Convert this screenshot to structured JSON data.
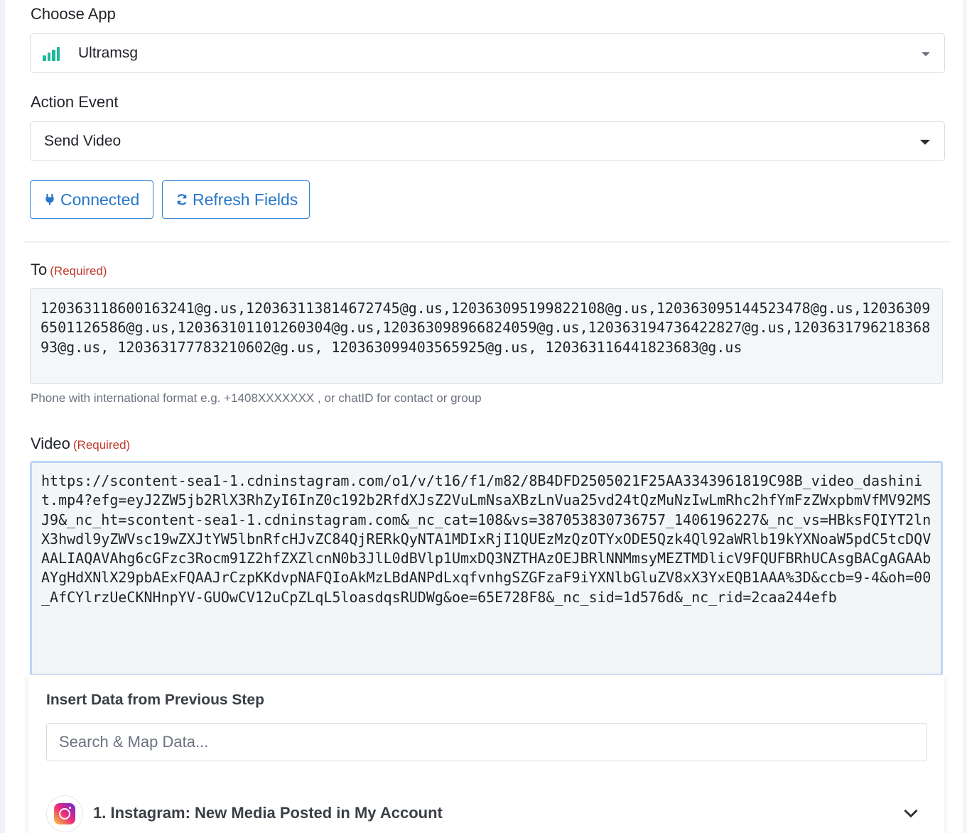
{
  "choose_app": {
    "label": "Choose App",
    "selected": "Ultramsg",
    "icon": "bar-chart-icon",
    "icon_color": "#1fb89a"
  },
  "action_event": {
    "label": "Action Event",
    "selected": "Send Video"
  },
  "buttons": {
    "connected_label": "Connected",
    "refresh_label": "Refresh Fields",
    "accent_color": "#2777c8"
  },
  "to_field": {
    "label": "To",
    "required_label": "(Required)",
    "value": "120363118600163241@g.us,120363113814672745@g.us,120363095199822108@g.us,120363095144523478@g.us,120363096501126586@g.us,120363101101260304@g.us,120363098966824059@g.us,120363194736422827@g.us,120363179621836893@g.us, 120363177783210602@g.us, 120363099403565925@g.us, 120363116441823683@g.us",
    "hint": "Phone with international format e.g. +1408XXXXXXX , or chatID for contact or group"
  },
  "video_field": {
    "label": "Video",
    "required_label": "(Required)",
    "value": "https://scontent-sea1-1.cdninstagram.com/o1/v/t16/f1/m82/8B4DFD2505021F25AA3343961819C98B_video_dashinit.mp4?efg=eyJ2ZW5jb2RlX3RhZyI6InZ0c192b2RfdXJsZ2VuLmNsaXBzLnVua25vd24tQzMuNzIwLmRhc2hfYmFzZWxpbmVfMV92MSJ9&_nc_ht=scontent-sea1-1.cdninstagram.com&_nc_cat=108&vs=387053830736757_1406196227&_nc_vs=HBksFQIYT2lnX3hwdl9yZWVsc19wZXJtYW5lbnRfcHJvZC84QjRERkQyNTA1MDIxRjI1QUEzMzQzOTYxODE5Qzk4Ql92aWRlb19kYXNoaW5pdC5tcDQVAALIAQAVAhg6cGFzc3Rocm91Z2hfZXZlcnN0b3JlL0dBVlp1UmxDQ3NZTHAzOEJBRlNNMmsyMEZTMDlicV9FQUFBRhUCAsgBACgAGAAbAYgHdXNlX29pbAExFQAAJrCzpKKdvpNAFQIoAkMzLBdANPdLxqfvnhgSZGFzaF9iYXNlbGluZV8xX3YxEQB1AAA%3D&ccb=9-4&oh=00_AfCYlrzUeCKNHnpYV-GUOwCV12uCpZLqL5loasdqsRUDWg&oe=65E728F8&_nc_sid=1d576d&_nc_rid=2caa244efb"
  },
  "insert_panel": {
    "title": "Insert Data from Previous Step",
    "search_placeholder": "Search & Map Data...",
    "steps": [
      {
        "label": "1. Instagram: New Media Posted in My Account",
        "icon": "instagram-icon"
      }
    ]
  }
}
